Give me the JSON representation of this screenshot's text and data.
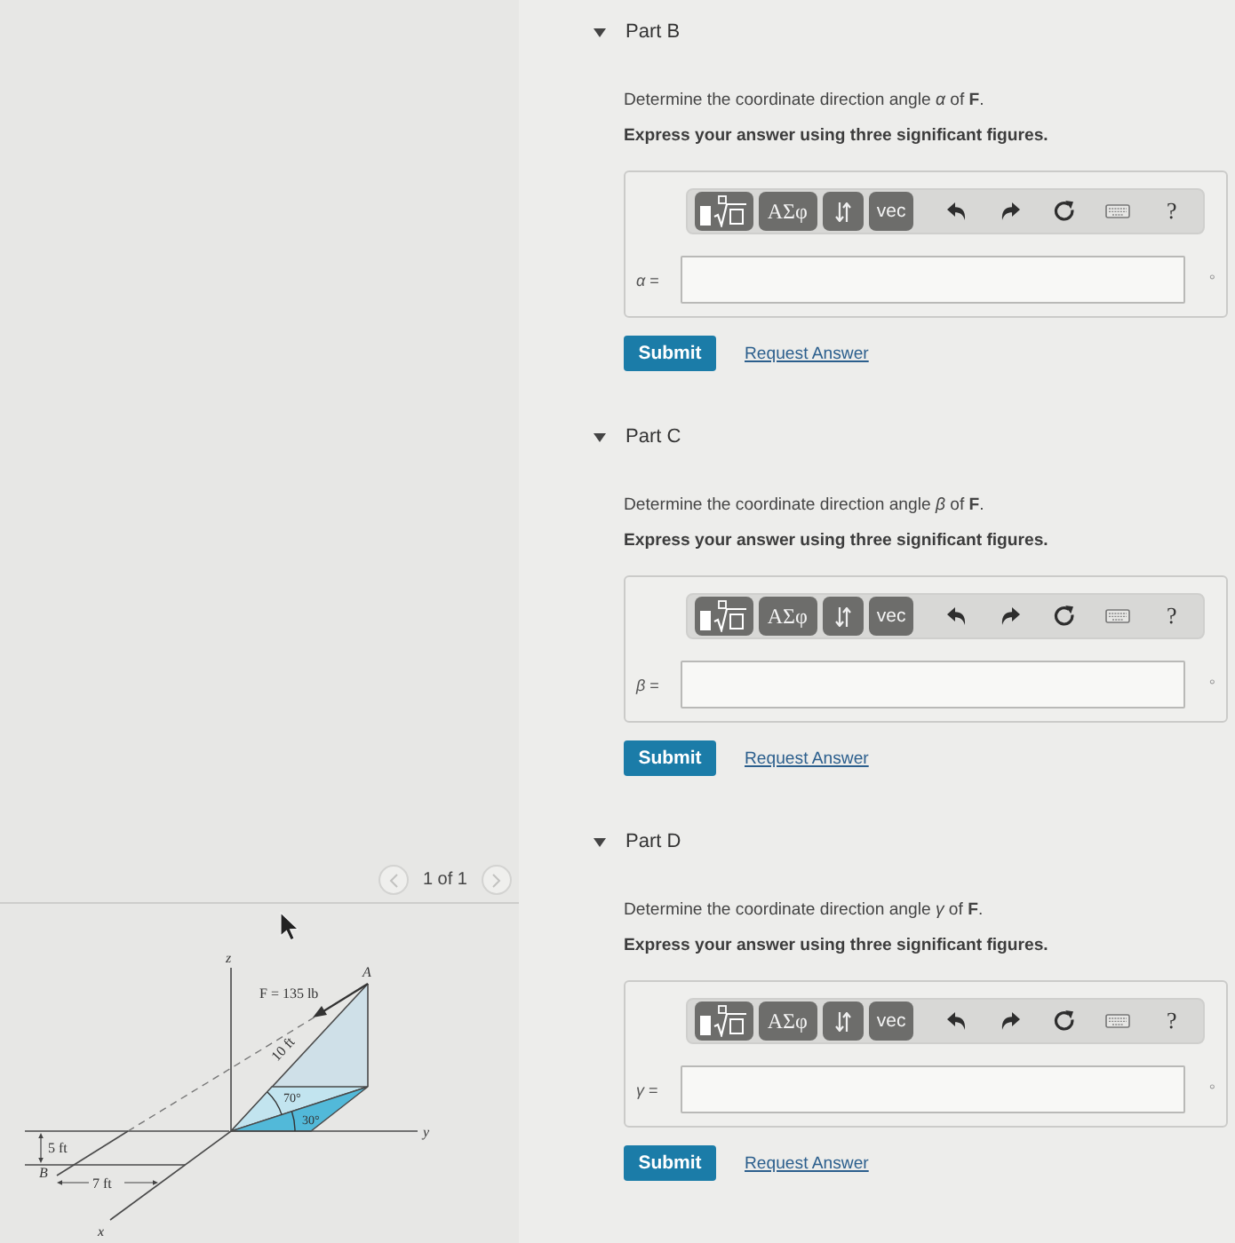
{
  "figure_panel": {
    "pager": {
      "label": "1 of 1",
      "previous_disabled": true,
      "next_disabled": true
    },
    "figure": {
      "labels": {
        "z_axis": "z",
        "point_a": "A",
        "force": "F = 135 lb",
        "length": "10 ft",
        "angle_upper": "70°",
        "angle_lower": "30°",
        "y_axis": "y",
        "offset_vertical": "5 ft",
        "point_b": "B",
        "offset_horizontal": "7 ft",
        "x_axis": "x"
      }
    }
  },
  "parts": [
    {
      "title": "Part B",
      "expanded": true,
      "prompt": "Determine the coordinate direction angle *α* of **F**.",
      "instruction": "Express your answer using three significant figures.",
      "toolbar": {
        "symbols": "ΑΣφ",
        "vector": "vec",
        "help": "?"
      },
      "answer_label": "*α* =",
      "unit": "°",
      "submit": "Submit",
      "request_answer": "Request Answer"
    },
    {
      "title": "Part C",
      "expanded": true,
      "prompt": "Determine the coordinate direction angle *β* of **F**.",
      "instruction": "Express your answer using three significant figures.",
      "toolbar": {
        "symbols": "ΑΣφ",
        "vector": "vec",
        "help": "?"
      },
      "answer_label": "*β* =",
      "unit": "°",
      "submit": "Submit",
      "request_answer": "Request Answer"
    },
    {
      "title": "Part D",
      "expanded": true,
      "prompt": "Determine the coordinate direction angle *γ* of **F**.",
      "instruction": "Express your answer using three significant figures.",
      "toolbar": {
        "symbols": "ΑΣφ",
        "vector": "vec",
        "help": "?"
      },
      "answer_label": "*γ* =",
      "unit": "°",
      "submit": "Submit",
      "request_answer": "Request Answer"
    }
  ]
}
